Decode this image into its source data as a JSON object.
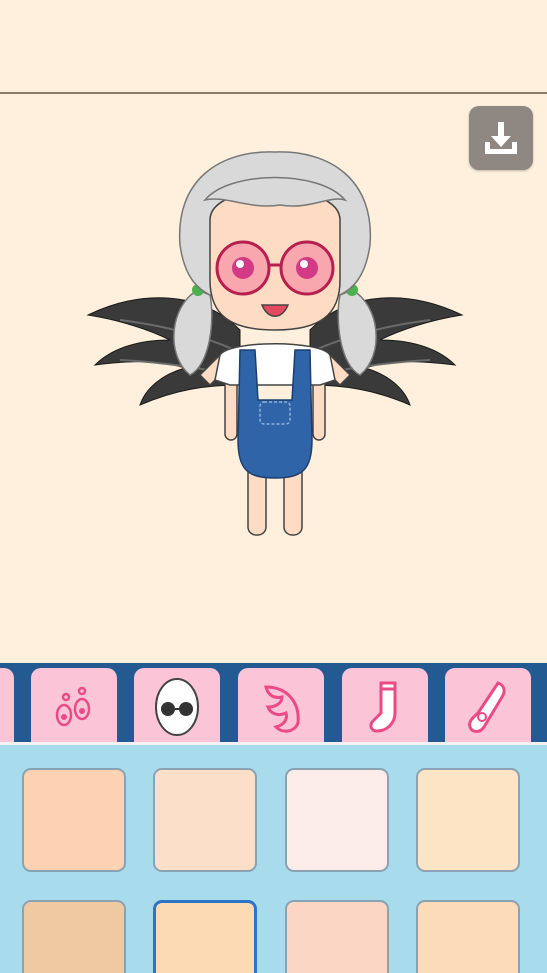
{
  "toolbar": {
    "download_icon": "download-icon"
  },
  "character": {
    "hair_color": "#d9d9d9",
    "skin_color": "#fddcc3",
    "eye_color": "#d23a86",
    "glasses_lens_color": "#f27c9b",
    "shirt_color": "#ffffff",
    "overalls_color": "#2f64a8",
    "wings_color": "#3a3a3a",
    "hair_tie_color": "#4caf50"
  },
  "tabs": [
    {
      "icon": "partial-tab-icon",
      "active": false
    },
    {
      "icon": "earrings-icon",
      "active": false
    },
    {
      "icon": "face-glasses-icon",
      "active": true
    },
    {
      "icon": "wing-icon",
      "active": false
    },
    {
      "icon": "sock-icon",
      "active": false
    },
    {
      "icon": "shoe-icon",
      "active": false
    }
  ],
  "swatches": [
    {
      "color": "#fcd2b2",
      "selected": false
    },
    {
      "color": "#fcdfc8",
      "selected": false
    },
    {
      "color": "#fbecea",
      "selected": false
    },
    {
      "color": "#fde4c4",
      "selected": false
    },
    {
      "color": "#eec9a1",
      "selected": false
    },
    {
      "color": "#fcdab3",
      "selected": true
    },
    {
      "color": "#fbd6c4",
      "selected": false
    },
    {
      "color": "#fcdbb8",
      "selected": false
    }
  ],
  "colors": {
    "background": "#fef0dc",
    "tab_bar": "#225a91",
    "tab": "#fbc5d7",
    "tab_icon": "#ec4a86",
    "swatch_panel": "#a8dbec",
    "download_button": "#8e8782"
  }
}
